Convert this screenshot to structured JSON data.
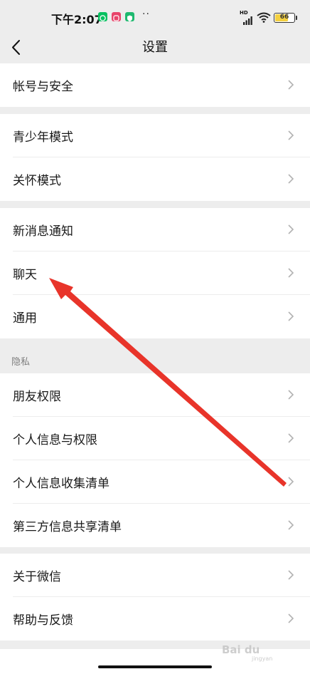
{
  "status_bar": {
    "time": "下午2:07",
    "app_icons": [
      "wechat-icon",
      "music-icon",
      "shield-icon"
    ],
    "hd_label": "HD",
    "battery_level": "66",
    "battery_fraction": 0.66,
    "colors": {
      "wechat": "#07c160",
      "music": "#e8436a",
      "shield": "#1fb96f",
      "battery": "#f4d03f"
    }
  },
  "nav": {
    "title": "设置",
    "back_icon": "chevron-left-icon"
  },
  "groups": [
    {
      "items": [
        "帐号与安全"
      ]
    },
    {
      "items": [
        "青少年模式",
        "关怀模式"
      ]
    },
    {
      "items": [
        "新消息通知",
        "聊天",
        "通用"
      ]
    },
    {
      "header": "隐私",
      "items": [
        "朋友权限",
        "个人信息与权限",
        "个人信息收集清单",
        "第三方信息共享清单"
      ]
    },
    {
      "items": [
        "关于微信",
        "帮助与反馈"
      ]
    }
  ],
  "annotation": {
    "type": "red-arrow",
    "points_to": "聊天",
    "color": "#e8342a"
  },
  "watermark": {
    "text": "Bai du",
    "sub": "jingyan"
  }
}
